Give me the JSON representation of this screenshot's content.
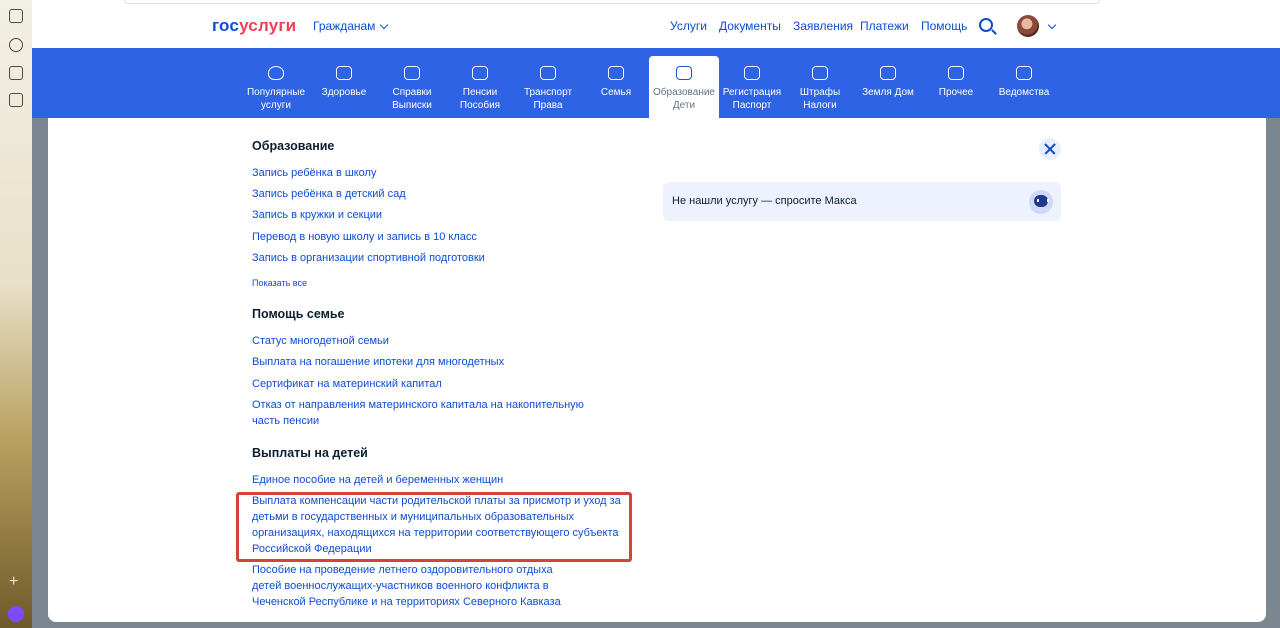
{
  "header": {
    "logo_gos": "гос",
    "logo_uslugi": "услуги",
    "audience": "Гражданам",
    "nav": [
      "Услуги",
      "Документы",
      "Заявления",
      "Платежи",
      "Помощь"
    ]
  },
  "categories": [
    {
      "line1": "Популярные",
      "line2": "услуги",
      "icon": "heart-icon"
    },
    {
      "line1": "Здоровье",
      "line2": "",
      "icon": "medical-cross-icon"
    },
    {
      "line1": "Справки",
      "line2": "Выписки",
      "icon": "folder-icon"
    },
    {
      "line1": "Пенсии",
      "line2": "Пособия",
      "icon": "wallet-icon"
    },
    {
      "line1": "Транспорт",
      "line2": "Права",
      "icon": "car-icon"
    },
    {
      "line1": "Семья",
      "line2": "",
      "icon": "stroller-icon"
    },
    {
      "line1": "Образование",
      "line2": "Дети",
      "icon": "book-icon"
    },
    {
      "line1": "Регистрация",
      "line2": "Паспорт",
      "icon": "passport-icon"
    },
    {
      "line1": "Штрафы",
      "line2": "Налоги",
      "icon": "gavel-icon"
    },
    {
      "line1": "Земля Дом",
      "line2": "",
      "icon": "house-icon"
    },
    {
      "line1": "Прочее",
      "line2": "",
      "icon": "grid-icon"
    },
    {
      "line1": "Ведомства",
      "line2": "",
      "icon": "emblem-icon"
    }
  ],
  "sections": {
    "education": {
      "title": "Образование",
      "links": [
        "Запись ребёнка в школу",
        "Запись ребёнка в детский сад",
        "Запись в кружки и секции",
        "Перевод в новую школу и запись в 10 класс",
        "Запись в организации спортивной подготовки"
      ],
      "show_all": "Показать все"
    },
    "family": {
      "title": "Помощь семье",
      "links": [
        "Статус многодетной семьи",
        "Выплата на погашение ипотеки для многодетных",
        "Сертификат на материнский капитал",
        "Отказ от направления материнского капитала на накопительную часть пенсии"
      ]
    },
    "child_payments": {
      "title": "Выплаты на детей",
      "links": [
        "Единое пособие на детей и беременных женщин",
        "Выплата компенсации части родительской платы за присмотр и уход за детьми в государственных и муниципальных образовательных организациях, находящихся на территории соответствующего субъекта Российской Федерации",
        "Пособие на проведение летнего оздоровительного отдыха детей военнослужащих-участников военного конфликта в Чеченской Республике и на территориях Северного Кавказа"
      ]
    }
  },
  "ask": {
    "text": "Не нашли услугу — спросите Макса"
  },
  "colors": {
    "brand_blue": "#0d4cd3",
    "band_blue": "#2f63e6",
    "brand_red": "#ee3f58",
    "highlight": "#d0443c"
  }
}
